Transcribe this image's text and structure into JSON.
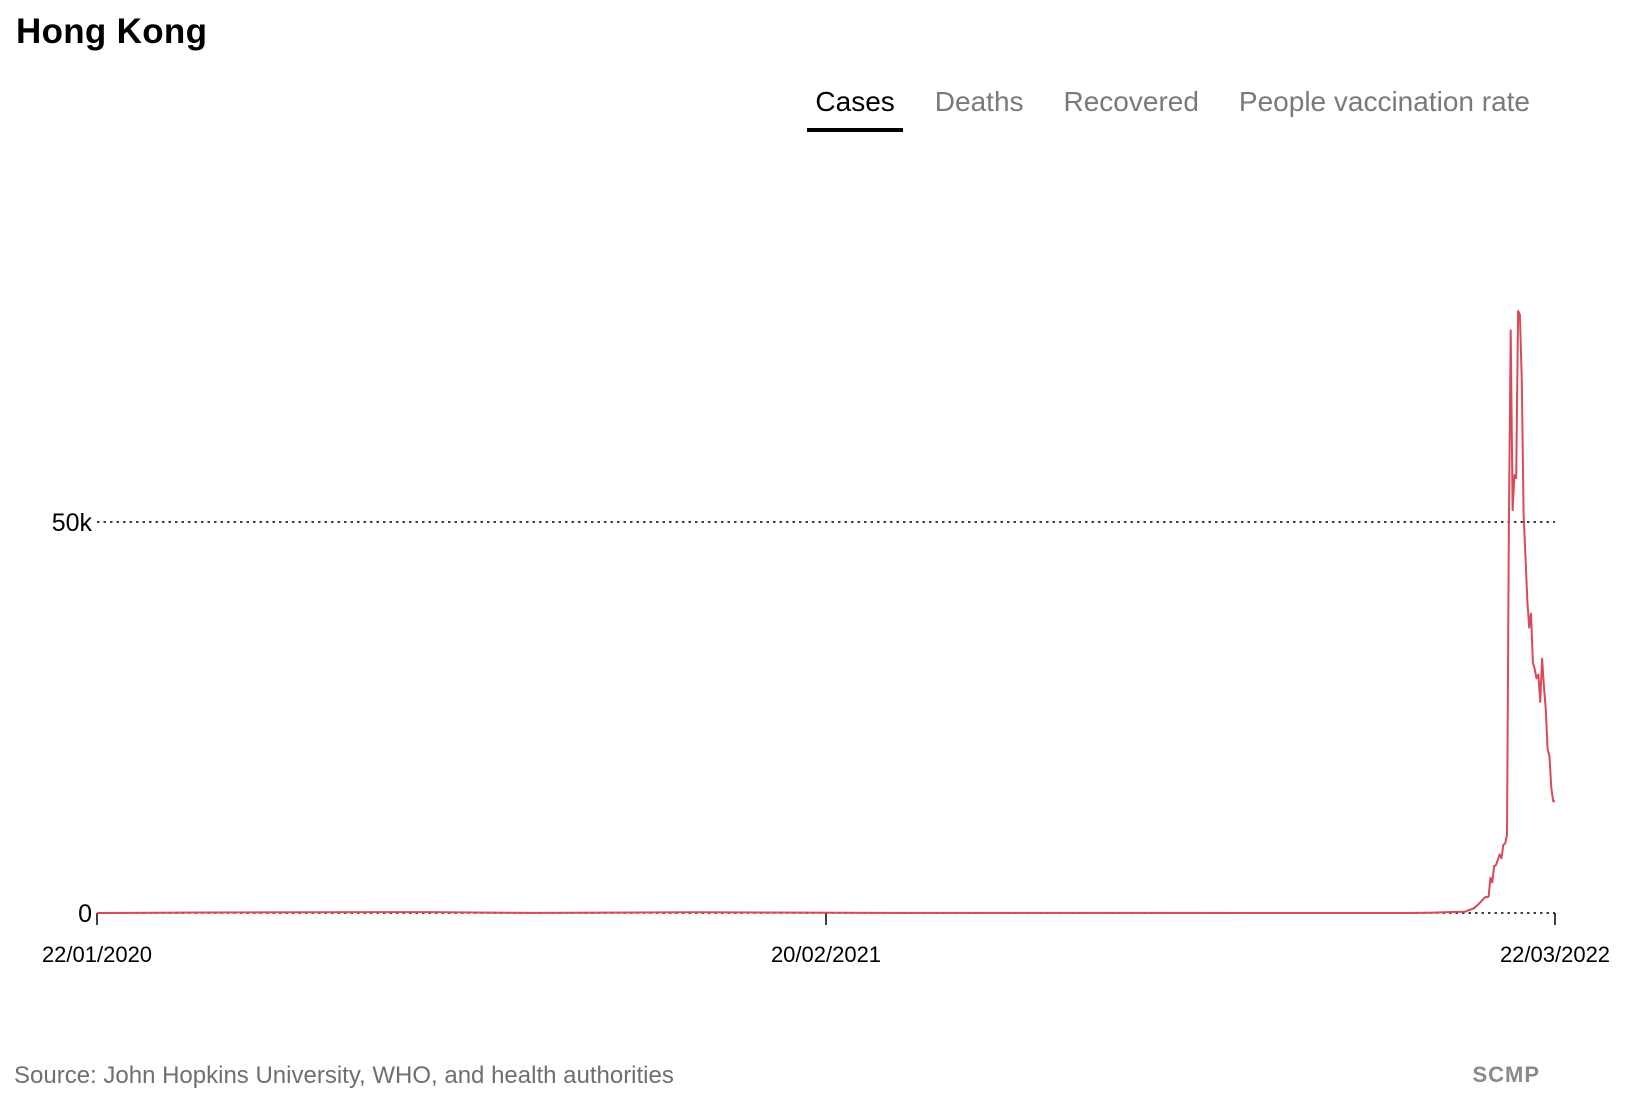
{
  "header": {
    "title": "Hong Kong"
  },
  "tabs": [
    {
      "label": "Cases",
      "active": true
    },
    {
      "label": "Deaths",
      "active": false
    },
    {
      "label": "Recovered",
      "active": false
    },
    {
      "label": "People vaccination rate",
      "active": false
    }
  ],
  "footer": {
    "source": "Source: John Hopkins University, WHO, and health authorities",
    "brand": "SCMP"
  },
  "colors": {
    "line": "#d94a58",
    "active_tab": "#000000",
    "inactive_tab": "#7a7a7a"
  },
  "chart_data": {
    "type": "line",
    "ylim": [
      0,
      50000
    ],
    "yticks": [
      {
        "value": 0,
        "label": "0"
      },
      {
        "value": 50000,
        "label": "50k"
      }
    ],
    "xlim": [
      "2020-01-22",
      "2022-03-22"
    ],
    "xticks": [
      {
        "date": "2020-01-22",
        "label": "22/01/2020"
      },
      {
        "date": "2021-02-20",
        "label": "20/02/2021"
      },
      {
        "date": "2022-03-22",
        "label": "22/03/2022"
      }
    ],
    "grid": "horizontal dotted",
    "series": [
      {
        "values": [
          [
            "2020-01-22",
            0
          ],
          [
            "2020-03-20",
            60
          ],
          [
            "2020-07-20",
            120
          ],
          [
            "2020-08-05",
            80
          ],
          [
            "2020-09-15",
            10
          ],
          [
            "2020-12-10",
            100
          ],
          [
            "2021-01-20",
            70
          ],
          [
            "2021-03-01",
            20
          ],
          [
            "2021-12-31",
            5
          ],
          [
            "2022-01-15",
            50
          ],
          [
            "2022-01-25",
            130
          ],
          [
            "2022-02-01",
            150
          ],
          [
            "2022-02-06",
            600
          ],
          [
            "2022-02-08",
            1000
          ],
          [
            "2022-02-10",
            1500
          ],
          [
            "2022-02-12",
            2000
          ],
          [
            "2022-02-14",
            2100
          ],
          [
            "2022-02-15",
            4500
          ],
          [
            "2022-02-16",
            3900
          ],
          [
            "2022-02-17",
            6000
          ],
          [
            "2022-02-18",
            6100
          ],
          [
            "2022-02-19",
            6800
          ],
          [
            "2022-02-20",
            7500
          ],
          [
            "2022-02-21",
            7000
          ],
          [
            "2022-02-22",
            8700
          ],
          [
            "2022-02-23",
            8900
          ],
          [
            "2022-02-24",
            10000
          ],
          [
            "2022-02-25",
            50000
          ],
          [
            "2022-02-26",
            74500
          ],
          [
            "2022-02-27",
            51500
          ],
          [
            "2022-02-28",
            56000
          ],
          [
            "2022-03-01",
            55600
          ],
          [
            "2022-03-02",
            77000
          ],
          [
            "2022-03-03",
            76500
          ],
          [
            "2022-03-04",
            68000
          ],
          [
            "2022-03-05",
            51000
          ],
          [
            "2022-03-06",
            45500
          ],
          [
            "2022-03-07",
            40000
          ],
          [
            "2022-03-08",
            36500
          ],
          [
            "2022-03-09",
            38300
          ],
          [
            "2022-03-10",
            32000
          ],
          [
            "2022-03-11",
            31200
          ],
          [
            "2022-03-12",
            30000
          ],
          [
            "2022-03-13",
            30500
          ],
          [
            "2022-03-14",
            27000
          ],
          [
            "2022-03-15",
            32500
          ],
          [
            "2022-03-16",
            29000
          ],
          [
            "2022-03-17",
            26000
          ],
          [
            "2022-03-18",
            21000
          ],
          [
            "2022-03-19",
            20000
          ],
          [
            "2022-03-20",
            16000
          ],
          [
            "2022-03-21",
            14300
          ],
          [
            "2022-03-22",
            14300
          ]
        ]
      }
    ]
  }
}
